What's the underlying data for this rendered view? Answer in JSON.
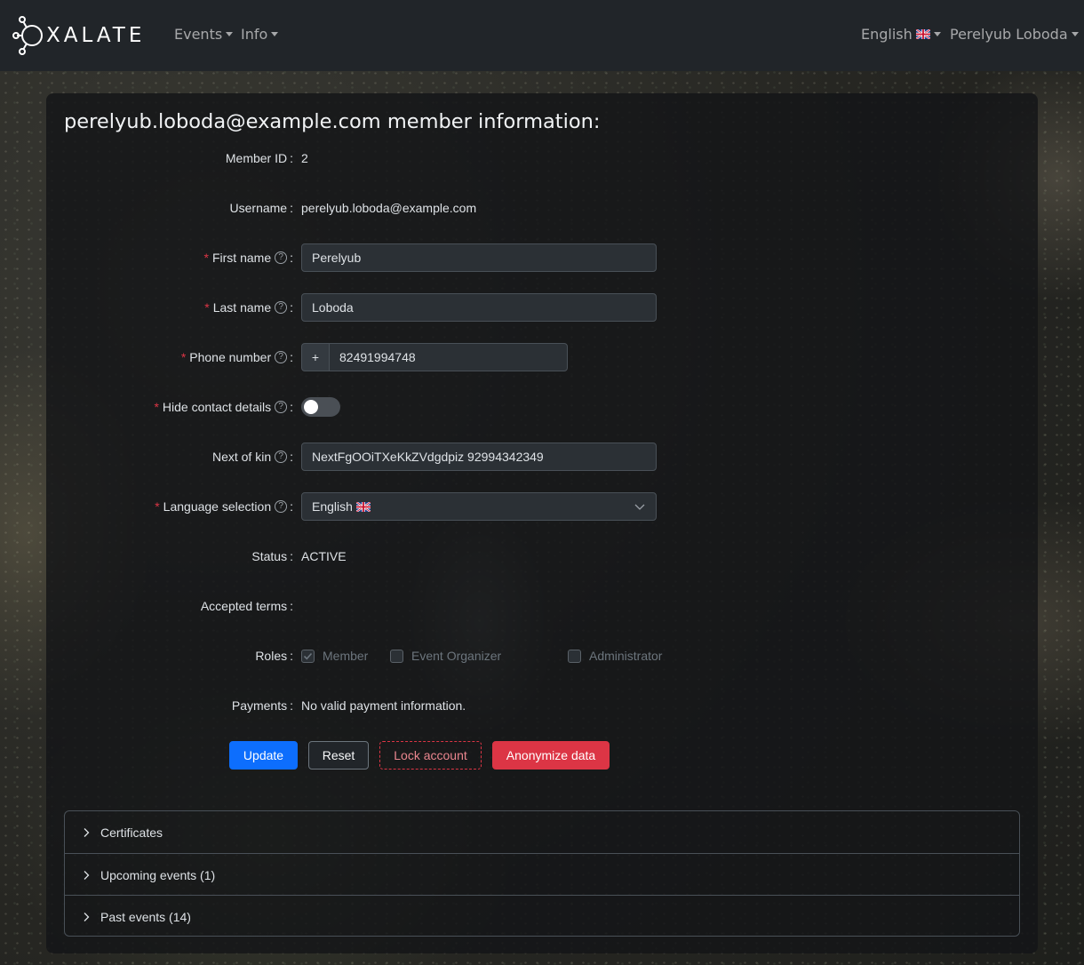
{
  "navbar": {
    "brand": "XALATE",
    "menu": [
      {
        "label": "Events"
      },
      {
        "label": "Info"
      }
    ],
    "language": "English",
    "user": "Perelyub Loboda"
  },
  "page": {
    "title": "perelyub.loboda@example.com member information:"
  },
  "form": {
    "member_id": {
      "label": "Member ID",
      "value": "2"
    },
    "username": {
      "label": "Username",
      "value": "perelyub.loboda@example.com"
    },
    "first_name": {
      "label": "First name",
      "value": "Perelyub",
      "required": "*"
    },
    "last_name": {
      "label": "Last name",
      "value": "Loboda",
      "required": "*"
    },
    "phone": {
      "label": "Phone number",
      "prefix": "+",
      "value": "82491994748",
      "required": "*"
    },
    "hide_contact": {
      "label": "Hide contact details",
      "checked": false,
      "required": "*"
    },
    "next_of_kin": {
      "label": "Next of kin",
      "value": "NextFgOOiTXeKkZVdgdpiz 92994342349"
    },
    "language": {
      "label": "Language selection",
      "value": "English",
      "required": "*"
    },
    "status": {
      "label": "Status",
      "value": "ACTIVE"
    },
    "accepted_terms": {
      "label": "Accepted terms",
      "value": ""
    },
    "roles": {
      "label": "Roles",
      "items": [
        {
          "label": "Member",
          "checked": true
        },
        {
          "label": "Event Organizer",
          "checked": false
        },
        {
          "label": "Administrator",
          "checked": false
        }
      ]
    },
    "payments": {
      "label": "Payments",
      "value": "No valid payment information."
    },
    "colon": ":",
    "help": "?"
  },
  "buttons": {
    "update": "Update",
    "reset": "Reset",
    "lock": "Lock account",
    "anonymize": "Anonymize data"
  },
  "accordion": [
    {
      "label": "Certificates"
    },
    {
      "label": "Upcoming events (1)"
    },
    {
      "label": "Past events (14)"
    }
  ],
  "colors": {
    "primary": "#0d6efd",
    "danger": "#dc3545",
    "navbar": "#212529"
  }
}
